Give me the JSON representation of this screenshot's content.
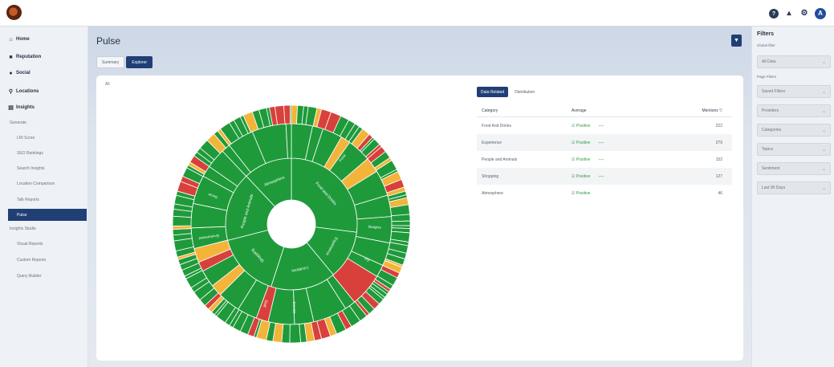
{
  "sidebar": {
    "items": [
      {
        "label": "Home",
        "icon": "home-icon"
      },
      {
        "label": "Reputation",
        "icon": "reputation-icon"
      },
      {
        "label": "Social",
        "icon": "social-icon"
      },
      {
        "label": "Locations",
        "icon": "location-pin-icon"
      },
      {
        "label": "Insights",
        "icon": "insights-icon"
      }
    ],
    "insights_section": "Generate",
    "insights_sub": [
      "LRI Score",
      "SEO Rankings",
      "Search Insights",
      "Location Comparison",
      "Talk Reports",
      "Pulse"
    ],
    "reports_section": "Insights Studio",
    "reports_sub": [
      "Visual Reports",
      "Custom Reports",
      "Query Builder"
    ]
  },
  "page": {
    "title": "Pulse",
    "tabs": [
      "Summary",
      "Explorer"
    ],
    "active_tab": "Explorer",
    "panel_tag": "All"
  },
  "table": {
    "tabs": [
      "Data Related",
      "Distribution"
    ],
    "headers": [
      "Category",
      "Average",
      "Mentions"
    ],
    "sort_indicator": "Mentions ▽",
    "rows": [
      {
        "category": "Food And Drinks",
        "average": "Positive",
        "change": "+++",
        "mentions": "222"
      },
      {
        "category": "Experience",
        "average": "Positive",
        "change": "+++",
        "mentions": "279"
      },
      {
        "category": "People and Animals",
        "average": "Positive",
        "change": "+++",
        "mentions": "152"
      },
      {
        "category": "Shopping",
        "average": "Positive",
        "change": "+++",
        "mentions": "127"
      },
      {
        "category": "Atmosphere",
        "average": "Positive",
        "change": "",
        "mentions": "46"
      }
    ]
  },
  "filters": {
    "title": "Filters",
    "global_label": "Global filter",
    "global_value": "All Data",
    "page_label": "Page Filters",
    "page_filters": [
      "Saved Filters",
      "Providers",
      "Categories",
      "Topics",
      "Sentiment",
      "Last 90 Days"
    ]
  },
  "sunburst": {
    "inner_labels": [
      "Food and Drinks",
      "Experience",
      "Locations",
      "Shopping",
      "People and Animals",
      "Atmosphere"
    ],
    "outer_labels": [
      "Food",
      "Burgers",
      "Fry",
      "Service",
      "Staff",
      "Environment",
      "Decor"
    ],
    "colors": {
      "positive": "#1f9a3b",
      "neutral": "#f3b43a",
      "negative": "#d8413b"
    }
  }
}
